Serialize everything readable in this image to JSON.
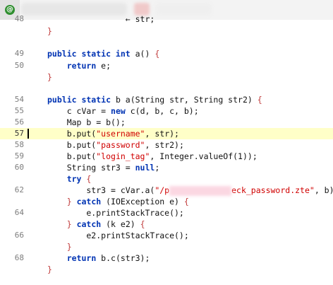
{
  "window": {
    "icon_label": "@"
  },
  "editor": {
    "lines": [
      {
        "num": "48",
        "code": "        ← str;"
      },
      {
        "num": "",
        "code": "    }"
      },
      {
        "num": "49",
        "code": "    public static int a() {"
      },
      {
        "num": "50",
        "code": "        return e;"
      },
      {
        "num": "",
        "code": "    }"
      },
      {
        "num": "54",
        "code": "    public static b a(String str, String str2) {"
      },
      {
        "num": "55",
        "code": "        c cVar = new c(d, b, c, b);"
      },
      {
        "num": "56",
        "code": "        Map b = b();"
      },
      {
        "num": "57",
        "code": "        b.put(\"username\", str);"
      },
      {
        "num": "58",
        "code": "        b.put(\"password\", str2);"
      },
      {
        "num": "59",
        "code": "        b.put(\"login_tag\", Integer.valueOf(1));"
      },
      {
        "num": "60",
        "code": "        String str3 = null;"
      },
      {
        "num": "",
        "code": "        try {"
      },
      {
        "num": "62",
        "code": "            str3 = cVar.a(\"/p…eck_password.zte\", b);"
      },
      {
        "num": "",
        "code": "        } catch (IOException e) {"
      },
      {
        "num": "64",
        "code": "            e.printStackTrace();"
      },
      {
        "num": "",
        "code": "        } catch (k e2) {"
      },
      {
        "num": "66",
        "code": "            e2.printStackTrace();"
      },
      {
        "num": "",
        "code": "        }"
      },
      {
        "num": "68",
        "code": "        return b.c(str3);"
      },
      {
        "num": "",
        "code": "    }"
      }
    ],
    "highlighted_line": "57"
  },
  "colors": {
    "keyword": "#0033b3",
    "string": "#d00000",
    "highlight": "#ffffc8"
  }
}
